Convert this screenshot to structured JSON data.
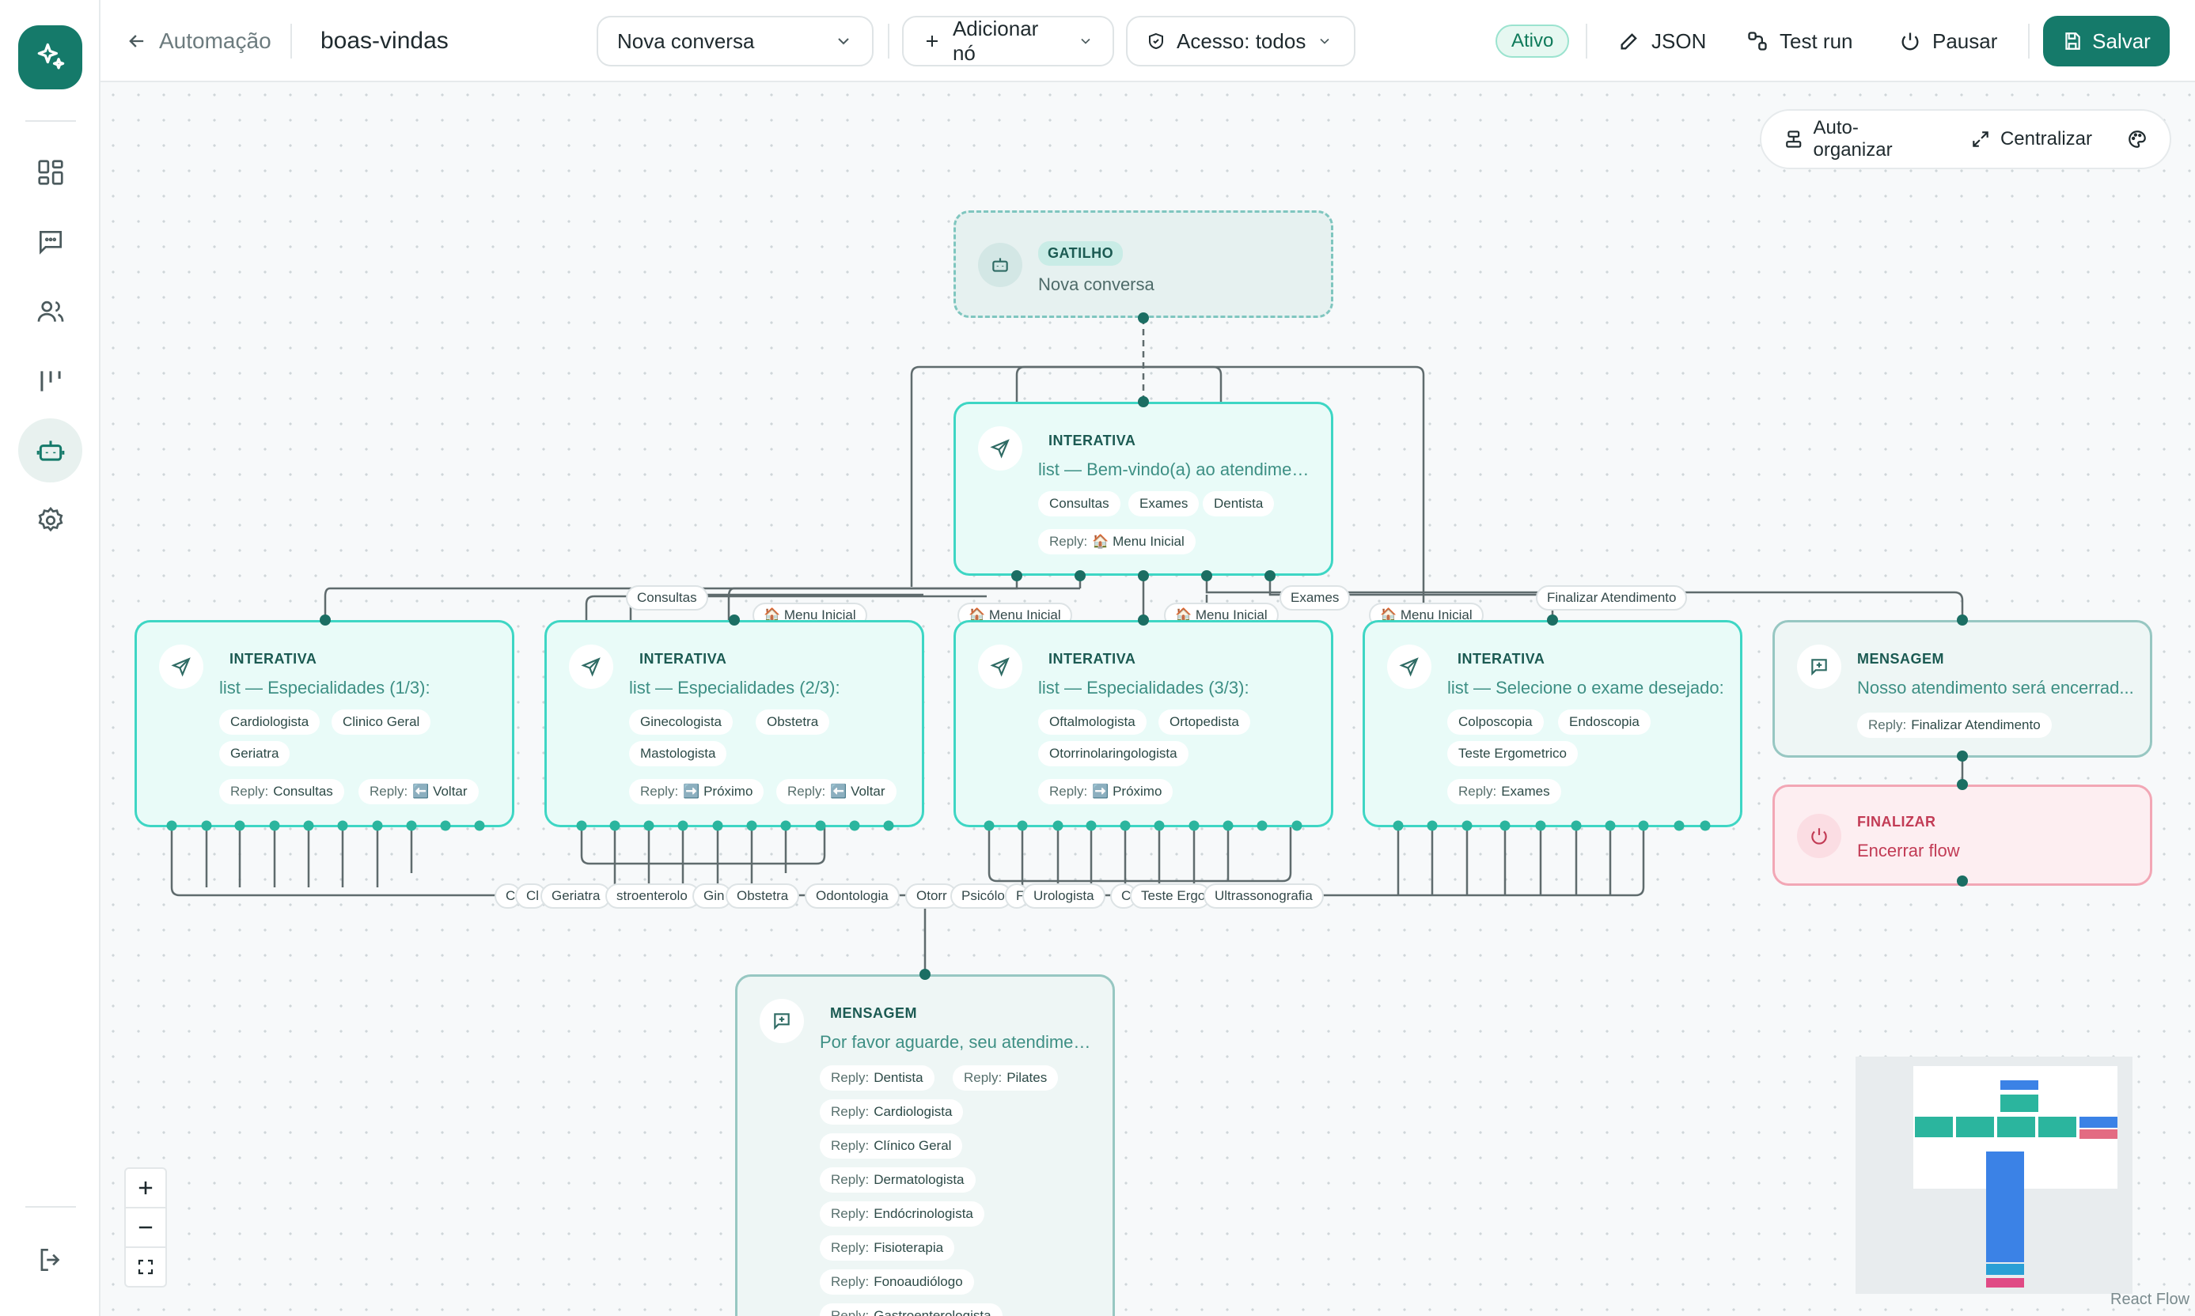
{
  "colors": {
    "brand": "#157a6a",
    "node_border": "#3ed6c4",
    "finalize": "#c23b55",
    "edge": "#5f6b6d"
  },
  "sidebar": {
    "logo_icon": "sparkle-icon",
    "items": [
      {
        "name": "dashboard",
        "icon": "grid-icon"
      },
      {
        "name": "conversas",
        "icon": "chat-icon"
      },
      {
        "name": "contatos",
        "icon": "users-icon"
      },
      {
        "name": "kanban",
        "icon": "columns-icon"
      },
      {
        "name": "automacao",
        "icon": "bot-icon"
      },
      {
        "name": "config",
        "icon": "gear-icon"
      }
    ],
    "logout_icon": "logout-icon"
  },
  "header": {
    "back_label": "Automação",
    "flow_name": "boas-vindas",
    "trigger_select": "Nova conversa",
    "add_node": "Adicionar nó",
    "access": "Acesso: todos",
    "status": "Ativo",
    "json": "JSON",
    "test_run": "Test run",
    "pause": "Pausar",
    "save": "Salvar"
  },
  "canvas_panel": {
    "auto_organize": "Auto-organizar",
    "center": "Centralizar"
  },
  "nodes": {
    "trigger": {
      "type": "GATILHO",
      "text": "Nova conversa"
    },
    "main": {
      "type": "INTERATIVA",
      "text": "list — Bem-vindo(a) ao atendiment...",
      "chips": [
        "Consultas",
        "Exames",
        "Dentista"
      ],
      "reply_prefix": "Reply:",
      "reply": "🏠 Menu Inicial"
    },
    "esp1": {
      "type": "INTERATIVA",
      "text": "list — Especialidades (1/3):",
      "chips": [
        "Cardiologista",
        "Clinico Geral",
        "Geriatra"
      ],
      "replies": [
        "Consultas",
        "⬅️ Voltar"
      ]
    },
    "esp2": {
      "type": "INTERATIVA",
      "text": "list — Especialidades (2/3):",
      "chips": [
        "Ginecologista",
        "Obstetra",
        "Mastologista"
      ],
      "replies": [
        "➡️ Próximo",
        "⬅️ Voltar"
      ]
    },
    "esp3": {
      "type": "INTERATIVA",
      "text": "list — Especialidades (3/3):",
      "chips": [
        "Oftalmologista",
        "Ortopedista",
        "Otorrinolaringologista"
      ],
      "replies": [
        "➡️ Próximo"
      ]
    },
    "exames": {
      "type": "INTERATIVA",
      "text": "list — Selecione o exame desejado:",
      "chips": [
        "Colposcopia",
        "Endoscopia",
        "Teste Ergometrico"
      ],
      "replies": [
        "Exames"
      ]
    },
    "msg_end": {
      "type": "MENSAGEM",
      "text": "Nosso atendimento será encerrad...",
      "replies": [
        "Finalizar Atendimento"
      ]
    },
    "finalizar": {
      "type": "FINALIZAR",
      "text": "Encerrar flow"
    },
    "msg_wait": {
      "type": "MENSAGEM",
      "text": "Por favor aguarde, seu atendiment...",
      "replies": [
        "Dentista",
        "Pilates",
        "Cardiologista",
        "Clínico Geral",
        "Dermatologista",
        "Endócrinologista",
        "Fisioterapia",
        "Fonoaudiólogo",
        "Gastroenterologista"
      ]
    }
  },
  "edge_labels": {
    "top": [
      "Consultas",
      "🏠 Menu Inicial",
      "🏠 Menu Inicial",
      "🏠 Menu Inicial",
      "Exames",
      "🏠 Menu Inicial",
      "Finalizar Atendimento"
    ],
    "bottom": [
      "C",
      "Cl",
      "Geriatra",
      "stroenterolo",
      "Gin",
      "Obstetra",
      "Odontologia",
      "Otorr",
      "Psicólo",
      "F",
      "Urologista",
      "C",
      "Teste Ergo",
      "Ultrassonografia"
    ]
  },
  "minimap": {
    "attribution": "React Flow"
  }
}
